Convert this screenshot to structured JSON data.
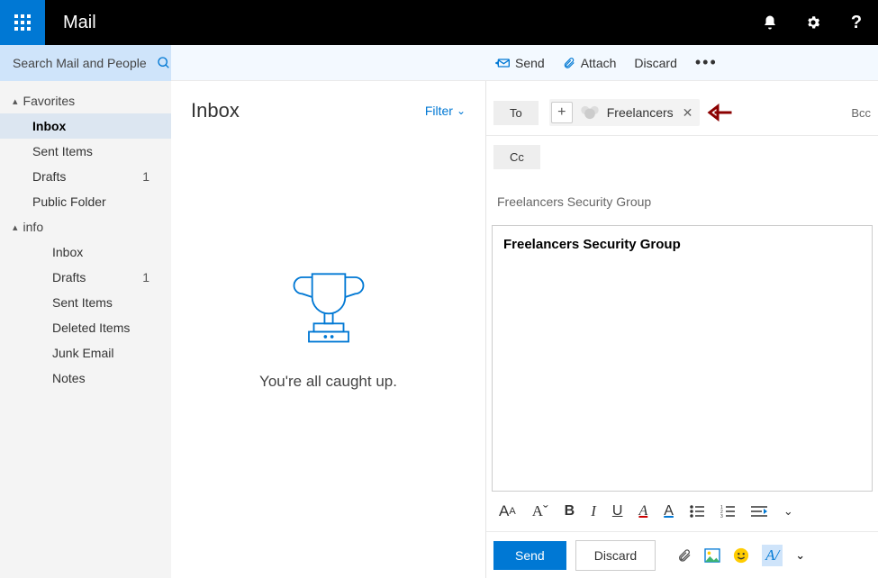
{
  "app": {
    "title": "Mail"
  },
  "search": {
    "placeholder": "Search Mail and People"
  },
  "compose_toolbar": {
    "send": "Send",
    "attach": "Attach",
    "discard": "Discard"
  },
  "sidebar": {
    "favorites_label": "Favorites",
    "favorites": [
      {
        "label": "Inbox",
        "count": "",
        "selected": true
      },
      {
        "label": "Sent Items",
        "count": ""
      },
      {
        "label": "Drafts",
        "count": "1"
      },
      {
        "label": "Public Folder",
        "count": ""
      }
    ],
    "account_label": "info",
    "account_folders": [
      {
        "label": "Inbox",
        "count": ""
      },
      {
        "label": "Drafts",
        "count": "1"
      },
      {
        "label": "Sent Items",
        "count": ""
      },
      {
        "label": "Deleted Items",
        "count": ""
      },
      {
        "label": "Junk Email",
        "count": ""
      },
      {
        "label": "Notes",
        "count": ""
      }
    ]
  },
  "msglist": {
    "title": "Inbox",
    "filter": "Filter",
    "empty_text": "You're all caught up."
  },
  "compose": {
    "to_label": "To",
    "cc_label": "Cc",
    "bcc_label": "Bcc",
    "recipient": "Freelancers",
    "subject": "Freelancers Security Group",
    "body": "Freelancers Security Group",
    "send": "Send",
    "discard": "Discard"
  }
}
